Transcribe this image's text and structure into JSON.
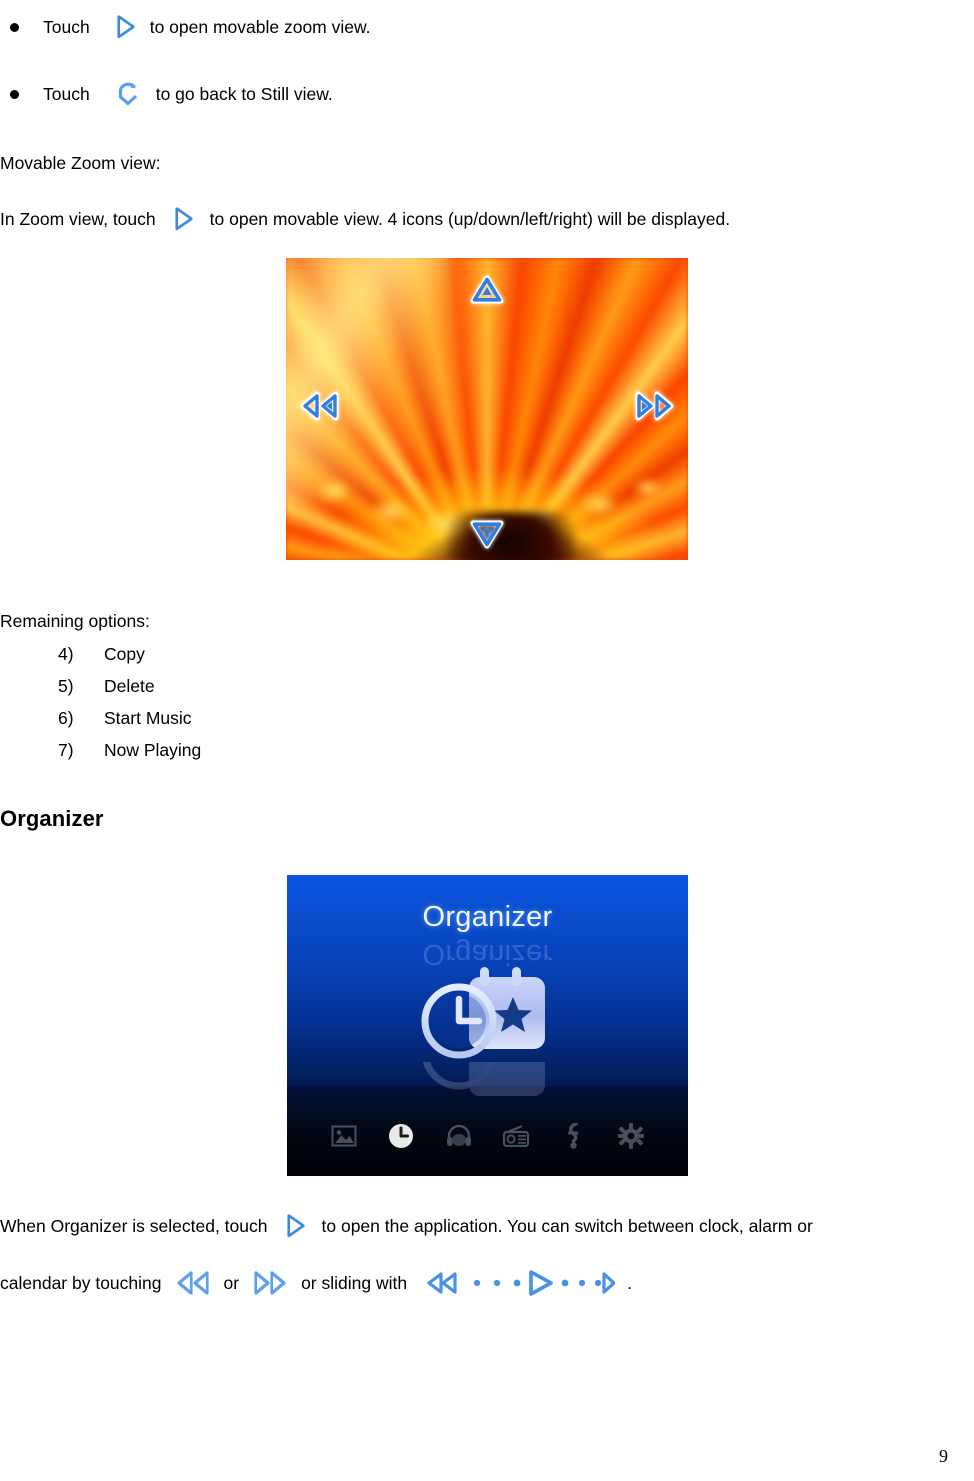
{
  "document": {
    "page_number": "9",
    "bullets": [
      {
        "lead": "Touch",
        "icon": "play-right-icon",
        "tail": "to open movable zoom view."
      },
      {
        "lead": "Touch",
        "icon": "back-return-icon",
        "tail": "to go back to Still view."
      }
    ],
    "section_movable_zoom": {
      "heading": "Movable Zoom view:",
      "line_lead": "In Zoom view, touch",
      "line_icon": "play-right-icon",
      "line_tail": "to open movable view. 4 icons (up/down/left/right) will be displayed."
    },
    "zoom_screenshot": {
      "caption": "Movable zoom view of an orange flower with four directional icons",
      "nav_icons": [
        "up-arrow-icon",
        "down-arrow-icon",
        "left-arrow-icon",
        "right-arrow-icon"
      ],
      "image_subject": "orange gerbera flower macro"
    },
    "remaining_options": {
      "heading": "Remaining options:",
      "items": [
        {
          "num": "4)",
          "label": "Copy"
        },
        {
          "num": "5)",
          "label": "Delete"
        },
        {
          "num": "6)",
          "label": "Start Music"
        },
        {
          "num": "7)",
          "label": "Now Playing"
        }
      ]
    },
    "organizer": {
      "heading": "Organizer",
      "screen": {
        "title": "Organizer",
        "icon": "clock-calendar-icon",
        "background_top": "#0b55e0",
        "background_bottom": "#000205",
        "nav_bar": [
          {
            "name": "photo-icon",
            "active": false
          },
          {
            "name": "clock-icon",
            "active": true
          },
          {
            "name": "headphones-icon",
            "active": false
          },
          {
            "name": "radio-icon",
            "active": false
          },
          {
            "name": "tools-icon",
            "active": false
          },
          {
            "name": "settings-gear-icon",
            "active": false
          }
        ]
      },
      "paragraph": {
        "part1": "When Organizer is selected, touch",
        "icon1": "play-right-icon",
        "part2": "to open the application. You can switch between clock, alarm or",
        "part3": "calendar by touching",
        "icon2": "rewind-double-left-icon",
        "part4": "or",
        "icon3": "forward-double-right-icon",
        "part5": "or sliding with",
        "icon4": "slider-track-icon",
        "part6": "."
      }
    }
  },
  "colors": {
    "icon_blue": "#4a90e8",
    "icon_blue_light": "#8fc0f2",
    "flower_orange": "#f04a05",
    "organizer_blue": "#0b4fd2"
  }
}
